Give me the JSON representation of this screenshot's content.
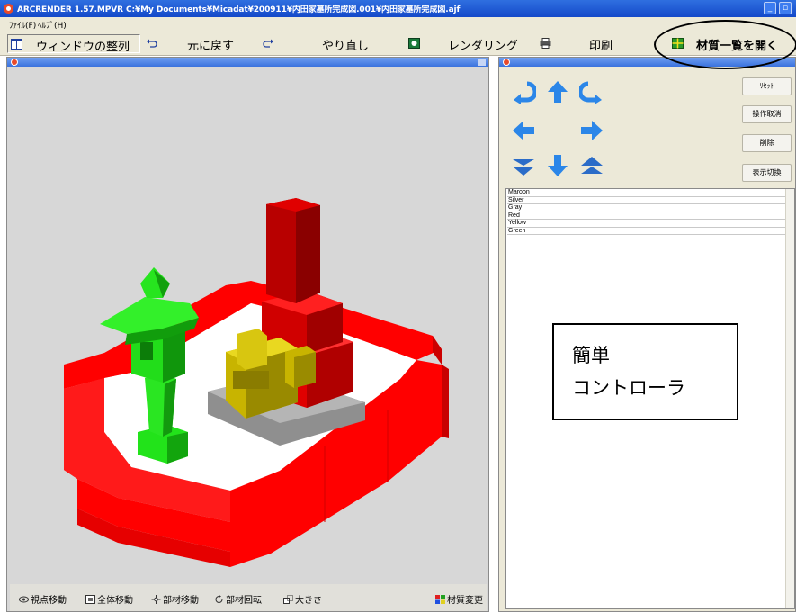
{
  "window": {
    "title": "ARCRENDER 1.57.MPVR   C:¥My Documents¥Micadat¥200911¥内田家墓所完成図.001¥内田家墓所完成図.ajf"
  },
  "menu": {
    "items": [
      "ﾌｧｲﾙ(F)",
      "ﾍﾙﾌﾟ(H)"
    ]
  },
  "toolbar": {
    "arrange_label": "ウィンドウの整列",
    "undo_label": "元に戻す",
    "redo_label": "やり直し",
    "render_label": "レンダリング",
    "print_label": "印刷",
    "materials_label": "材質一覧を開く"
  },
  "viewer": {
    "bottom": {
      "viewpoint_move": "視点移動",
      "all_move": "全体移動",
      "part_move": "部材移動",
      "part_rotate": "部材回転",
      "size": "大きさ",
      "material_change": "材質変更"
    }
  },
  "controller": {
    "buttons": {
      "reset": "ﾘｾｯﾄ",
      "cancel": "操作取消",
      "delete": "削除",
      "display_toggle": "表示切換"
    },
    "materials": [
      "Maroon",
      "Silver",
      "Gray",
      "Red",
      "Yellow",
      "Green"
    ]
  },
  "annotation": {
    "line1": "簡単",
    "line2": "コントローラ"
  },
  "colors": {
    "titlebar": "#1a54d8",
    "toolbar": "#ece9d8",
    "arrow_blue": "#2b86e8",
    "monument_red": "#c40000",
    "border_red": "#ff0000",
    "lantern_green": "#22e31a",
    "gold": "#c8b400"
  }
}
